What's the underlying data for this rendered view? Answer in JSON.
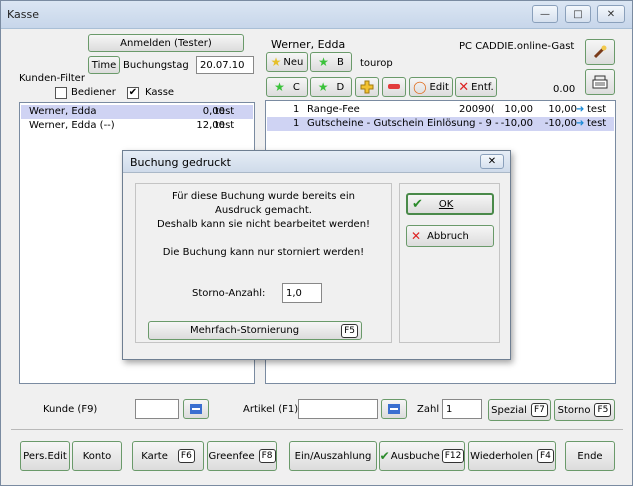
{
  "window": {
    "title": "Kasse"
  },
  "left": {
    "login_button": "Anmelden (Tester)",
    "time_button": "Time",
    "booking_day_label": "Buchungstag",
    "booking_day_value": "20.07.10",
    "filter_label": "Kunden-Filter",
    "bediener_label": "Bediener",
    "bediener_checked": false,
    "kasse_label": "Kasse",
    "kasse_checked": true,
    "customers": [
      {
        "name": "Werner, Edda",
        "amount": "0,00",
        "user": "test"
      },
      {
        "name": "Werner, Edda (--)",
        "amount": "12,00",
        "user": "test"
      }
    ]
  },
  "right": {
    "customer_name": "Werner, Edda",
    "system_name": "PC CADDIE.online-Gast",
    "tag": "tourop",
    "total": "0.00",
    "buttons": {
      "neu": "Neu",
      "b": "B",
      "c": "C",
      "d": "D",
      "edit": "Edit",
      "entf": "Entf."
    },
    "bookings": [
      {
        "qty": "1",
        "text": "Range-Fee",
        "code": "20090(",
        "price": "10,00",
        "total": "10,00",
        "user": "test"
      },
      {
        "qty": "1",
        "text": "Gutscheine - Gutschein Einlösung - 9 -",
        "code": "",
        "price": "-10,00",
        "total": "-10,00",
        "user": "test"
      }
    ]
  },
  "dialog": {
    "title": "Buchung gedruckt",
    "line1": "Für diese Buchung wurde bereits ein",
    "line2": "Ausdruck gemacht.",
    "line3": "Deshalb kann sie nicht bearbeitet werden!",
    "line4": "Die Buchung kann nur storniert werden!",
    "storno_label": "Storno-Anzahl:",
    "storno_value": "1,0",
    "multi_button": "Mehrfach-Stornierung",
    "multi_key": "F5",
    "ok": "OK",
    "abbruch": "Abbruch"
  },
  "search": {
    "kunde_label": "Kunde (F9)",
    "artikel_label": "Artikel (F1)",
    "zahl_label": "Zahl",
    "zahl_value": "1",
    "spezial": "Spezial",
    "spezial_key": "F7",
    "storno": "Storno",
    "storno_key": "F5"
  },
  "footer": {
    "pers_edit": "Pers.Edit",
    "konto": "Konto",
    "karte": "Karte",
    "karte_key": "F6",
    "greenfee": "Greenfee",
    "greenfee_key": "F8",
    "ein_aus": "Ein/Auszahlung",
    "ausbuchen": "Ausbuche",
    "ausbuchen_key": "F12",
    "wiederholen": "Wiederholen",
    "wiederholen_key": "F4",
    "ende": "Ende"
  }
}
